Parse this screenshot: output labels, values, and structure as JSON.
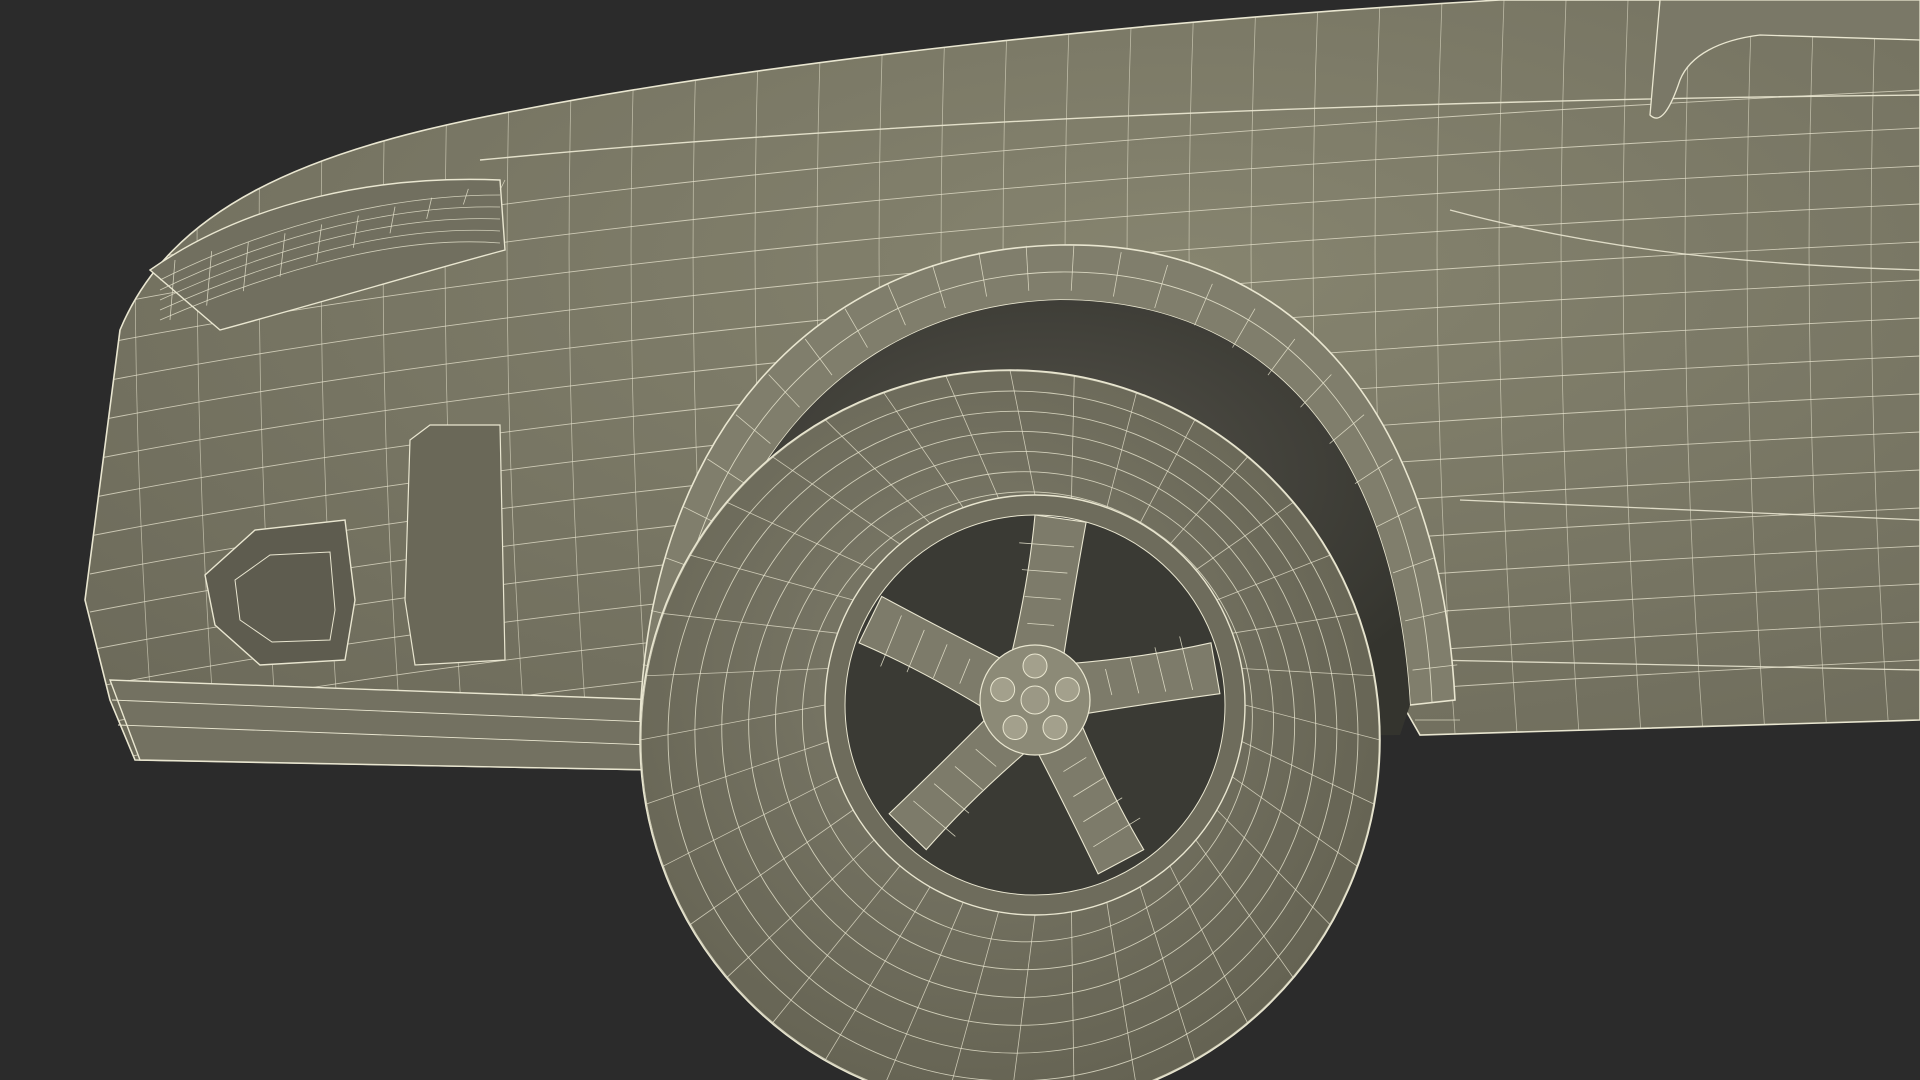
{
  "scene": {
    "subject": "car-front-wheel-wireframe-render",
    "colors": {
      "background": "#2b2b2b",
      "body_shade": "#7b7968",
      "body_dark": "#55534a",
      "wire": "#e9e6d0",
      "wheel_well": "#3f3f37",
      "hub_cap": "#9b9885"
    }
  }
}
